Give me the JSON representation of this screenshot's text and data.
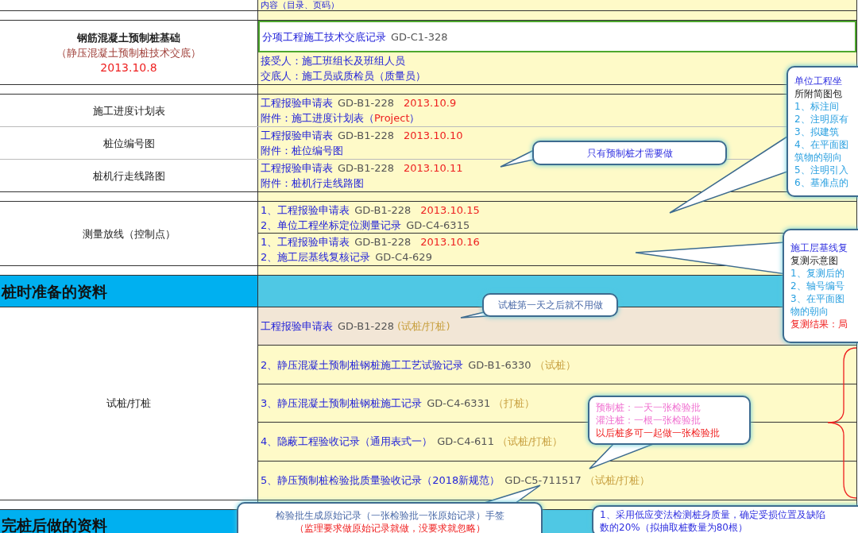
{
  "header_row": {
    "column_2": "内容（目录、页码）"
  },
  "blocks": [
    {
      "rows": [
        {
          "kind": "group",
          "label": [
            {
              "kind": "heading",
              "text": "钢筋混凝土预制桩基础"
            },
            {
              "kind": "subtitle",
              "text": "（静压混凝土预制桩技术交底）"
            },
            {
              "kind": "date",
              "text": "2013.10.8"
            }
          ],
          "cells": [
            {
              "selected": true,
              "highlighted": false,
              "lines": [
                [
                  {
                    "kind": "title",
                    "text": "分项工程施工技术交底记录"
                  },
                  {
                    "kind": "code",
                    "text": "GD-C1-328"
                  }
                ]
              ]
            },
            {
              "selected": false,
              "highlighted": false,
              "lines": [
                [
                  {
                    "kind": "title",
                    "text": "接受人：施工班组长及班组人员"
                  }
                ],
                [
                  {
                    "kind": "title",
                    "text": "交底人：施工员或质检员（质量员）"
                  }
                ]
              ]
            }
          ]
        }
      ]
    },
    {
      "rows": [
        {
          "kind": "group",
          "label": [
            {
              "kind": "title",
              "text": "施工进度计划表"
            }
          ],
          "cells": [
            {
              "selected": false,
              "highlighted": false,
              "lines": [
                [
                  {
                    "kind": "title",
                    "text": "工程报验申请表"
                  },
                  {
                    "kind": "code",
                    "text": "GD-B1-228"
                  },
                  {
                    "kind": "date",
                    "text": "2013.10.9"
                  }
                ],
                [
                  {
                    "kind": "title",
                    "text": "附件：施工进度计划表（"
                  },
                  {
                    "kind": "red",
                    "text": "Project"
                  },
                  {
                    "kind": "title",
                    "text": "）"
                  }
                ]
              ]
            }
          ]
        },
        {
          "kind": "group",
          "label": [
            {
              "kind": "title",
              "text": "桩位编号图"
            }
          ],
          "cells": [
            {
              "selected": false,
              "highlighted": false,
              "lines": [
                [
                  {
                    "kind": "title",
                    "text": "工程报验申请表"
                  },
                  {
                    "kind": "code",
                    "text": "GD-B1-228"
                  },
                  {
                    "kind": "date",
                    "text": "2013.10.10"
                  }
                ],
                [
                  {
                    "kind": "title",
                    "text": "附件：桩位编号图"
                  }
                ]
              ]
            }
          ]
        },
        {
          "kind": "group",
          "label": [
            {
              "kind": "title",
              "text": "桩机行走线路图"
            }
          ],
          "cells": [
            {
              "selected": false,
              "highlighted": false,
              "lines": [
                [
                  {
                    "kind": "title",
                    "text": "工程报验申请表"
                  },
                  {
                    "kind": "code",
                    "text": "GD-B1-228"
                  },
                  {
                    "kind": "date",
                    "text": "2013.10.11"
                  }
                ],
                [
                  {
                    "kind": "title",
                    "text": "附件：桩机行走线路图"
                  }
                ]
              ]
            }
          ]
        }
      ]
    },
    {
      "rows": [
        {
          "kind": "group",
          "label": [
            {
              "kind": "title",
              "text": "测量放线（控制点）"
            }
          ],
          "cells": [
            {
              "selected": false,
              "highlighted": false,
              "lines": [
                [
                  {
                    "kind": "title",
                    "text": "1、工程报验申请表"
                  },
                  {
                    "kind": "code",
                    "text": "GD-B1-228"
                  },
                  {
                    "kind": "date",
                    "text": "2013.10.15"
                  }
                ],
                [
                  {
                    "kind": "title",
                    "text": "2、单位工程坐标定位测量记录"
                  },
                  {
                    "kind": "code",
                    "text": "GD-C4-6315"
                  }
                ]
              ]
            },
            {
              "selected": false,
              "highlighted": false,
              "lines": [
                [
                  {
                    "kind": "title",
                    "text": "1、工程报验申请表"
                  },
                  {
                    "kind": "code",
                    "text": "GD-B1-228"
                  },
                  {
                    "kind": "date",
                    "text": "2013.10.16"
                  }
                ],
                [
                  {
                    "kind": "title",
                    "text": "2、施工层基线复核记录"
                  },
                  {
                    "kind": "code",
                    "text": "GD-C4-629"
                  }
                ]
              ]
            }
          ]
        }
      ]
    },
    {
      "rows": [
        {
          "kind": "section",
          "title": "桩时准备的资料"
        },
        {
          "kind": "group",
          "label": [
            {
              "kind": "title",
              "text": "试桩/打桩"
            }
          ],
          "cells": [
            {
              "selected": false,
              "highlighted": true,
              "lines": [
                [
                  {
                    "kind": "title",
                    "text": "工程报验申请表"
                  },
                  {
                    "kind": "code",
                    "text": "GD-B1-228"
                  },
                  {
                    "kind": "tag",
                    "text": "(试桩/打桩)"
                  }
                ]
              ]
            },
            {
              "selected": false,
              "highlighted": false,
              "lines": [
                [
                  {
                    "kind": "title",
                    "text": "2、静压混凝土预制桩钢桩施工工艺试验记录"
                  },
                  {
                    "kind": "code",
                    "text": "GD-B1-6330"
                  },
                  {
                    "kind": "tag",
                    "text": "（试桩）"
                  }
                ]
              ]
            },
            {
              "selected": false,
              "highlighted": false,
              "lines": [
                [
                  {
                    "kind": "title",
                    "text": "3、静压混凝土预制桩钢桩施工记录"
                  },
                  {
                    "kind": "code",
                    "text": "GD-C4-6331"
                  },
                  {
                    "kind": "tag",
                    "text": "（打桩）"
                  }
                ]
              ]
            },
            {
              "selected": false,
              "highlighted": false,
              "lines": [
                [
                  {
                    "kind": "title",
                    "text": "4、隐蔽工程验收记录（通用表式一）"
                  },
                  {
                    "kind": "code",
                    "text": "GD-C4-611"
                  },
                  {
                    "kind": "tag",
                    "text": "（试桩/打桩）"
                  }
                ]
              ]
            },
            {
              "selected": false,
              "highlighted": false,
              "lines": [
                [
                  {
                    "kind": "title",
                    "text": "5、静压预制桩检验批质量验收记录（2018新规范）"
                  },
                  {
                    "kind": "code",
                    "text": "GD-C5-711517"
                  },
                  {
                    "kind": "tag",
                    "text": "（试桩/打桩）"
                  }
                ]
              ]
            }
          ]
        }
      ]
    },
    {
      "rows": [
        {
          "kind": "section",
          "title": "完桩后做的资料"
        }
      ]
    }
  ],
  "callouts": [
    {
      "lines": [
        {
          "kind": "heading",
          "text": "只有预制桩才需要做"
        }
      ]
    },
    {
      "lines": [
        {
          "kind": "heading",
          "text": "单位工程坐"
        },
        {
          "kind": "plain",
          "text": "所附简图包"
        },
        {
          "kind": "item",
          "text": "1、标注间"
        },
        {
          "kind": "item",
          "text": "2、注明原有"
        },
        {
          "kind": "item",
          "text": "3、拟建筑"
        },
        {
          "kind": "item",
          "text": "4、在平面图"
        },
        {
          "kind": "item",
          "text": "筑物的朝向"
        },
        {
          "kind": "item",
          "text": "5、注明引入"
        },
        {
          "kind": "item",
          "text": "6、基准点的"
        }
      ]
    },
    {
      "lines": [
        {
          "kind": "heading",
          "text": "施工层基线复"
        },
        {
          "kind": "plain",
          "text": "复测示意图"
        },
        {
          "kind": "item",
          "text": "1、复测后的"
        },
        {
          "kind": "item",
          "text": "2、轴号编号"
        },
        {
          "kind": "item",
          "text": "3、在平面图"
        },
        {
          "kind": "item",
          "text": "物的朝向"
        },
        {
          "kind": "alert",
          "text": "复测结果：局"
        }
      ]
    },
    {
      "lines": [
        {
          "kind": "note",
          "text": "试桩第一天之后就不用做"
        }
      ]
    },
    {
      "lines": [
        {
          "kind": "soft",
          "text": "预制桩：一天一张检验批"
        },
        {
          "kind": "soft",
          "text": "灌注桩：一根一张检验批"
        },
        {
          "kind": "alert",
          "text": "以后桩多可一起做一张检验批"
        }
      ]
    },
    {
      "lines": [
        {
          "kind": "note",
          "text": "检验批生成原始记录（一张检验批一张原始记录）手签"
        },
        {
          "kind": "alert",
          "text": "（监理要求做原始记录就做，没要求就忽略）"
        }
      ]
    },
    {
      "lines": [
        {
          "kind": "heading",
          "text": "1、采用低应变法检测桩身质量，确定受损位置及缺陷"
        },
        {
          "kind": "heading",
          "text": "数的20%（拟抽取桩数量为80根）"
        }
      ]
    }
  ]
}
